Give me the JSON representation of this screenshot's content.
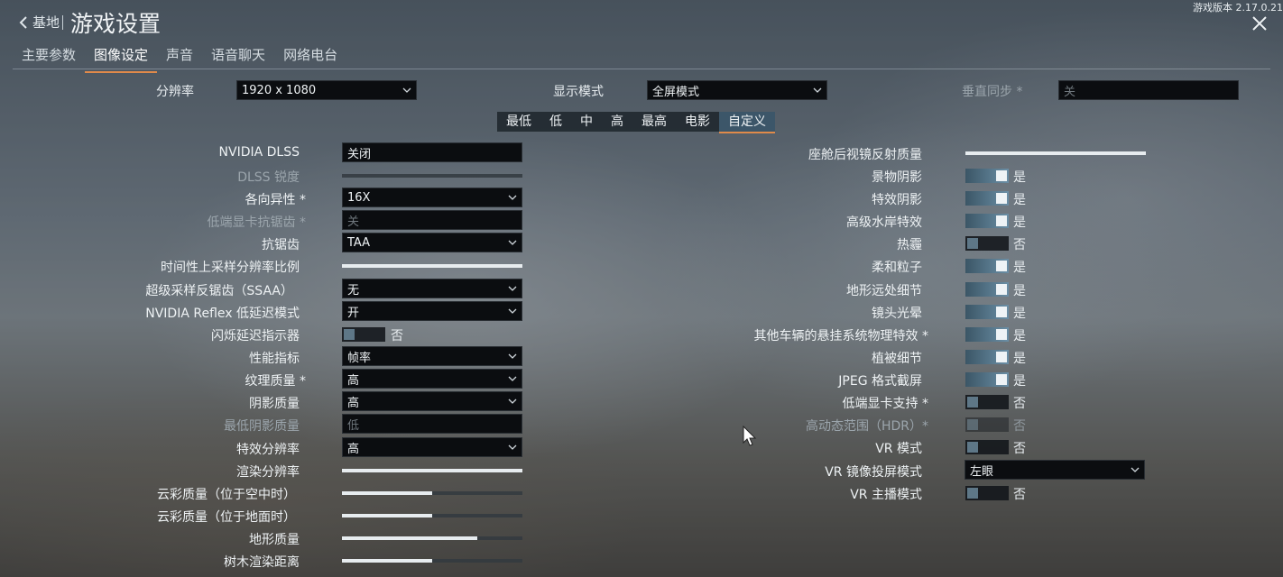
{
  "header": {
    "back_label": "基地",
    "title": "游戏设置",
    "version": "游戏版本 2.17.0.21"
  },
  "tabs": [
    "主要参数",
    "图像设定",
    "声音",
    "语音聊天",
    "网络电台"
  ],
  "top": {
    "resolution_label": "分辨率",
    "resolution_value": "1920 x 1080",
    "display_mode_label": "显示模式",
    "display_mode_value": "全屏模式",
    "vsync_label": "垂直同步 *",
    "vsync_value": "关"
  },
  "presets": [
    "最低",
    "低",
    "中",
    "高",
    "最高",
    "电影",
    "自定义"
  ],
  "left": {
    "dlss_label": "NVIDIA DLSS",
    "dlss_value": "关闭",
    "dlss_sharpness_label": "DLSS 锐度",
    "aniso_label": "各向异性 *",
    "aniso_value": "16X",
    "lowend_aa_label": "低端显卡抗锯齿 *",
    "lowend_aa_value": "关",
    "aa_label": "抗锯齿",
    "aa_value": "TAA",
    "temporal_upscale_label": "时间性上采样分辨率比例",
    "temporal_upscale_level": 1.0,
    "ssaa_label": "超级采样反锯齿（SSAA）",
    "ssaa_value": "无",
    "reflex_label": "NVIDIA Reflex 低延迟模式",
    "reflex_value": "开",
    "flash_label": "闪烁延迟指示器",
    "flash_value": "否",
    "perf_label": "性能指标",
    "perf_value": "帧率",
    "texture_label": "纹理质量 *",
    "texture_value": "高",
    "shadow_label": "阴影质量",
    "shadow_value": "高",
    "min_shadow_label": "最低阴影质量",
    "min_shadow_value": "低",
    "fx_res_label": "特效分辨率",
    "fx_res_value": "高",
    "render_res_label": "渲染分辨率",
    "render_res_level": 1.0,
    "cloud_air_label": "云彩质量（位于空中时）",
    "cloud_air_level": 0.5,
    "cloud_ground_label": "云彩质量（位于地面时）",
    "cloud_ground_level": 0.5,
    "terrain_label": "地形质量",
    "terrain_level": 0.75,
    "tree_label": "树木渲染距离",
    "tree_level": 0.5
  },
  "right": {
    "mirror_label": "座舱后视镜反射质量",
    "mirror_level": 1.0,
    "items": [
      {
        "label": "景物阴影",
        "value": "是"
      },
      {
        "label": "特效阴影",
        "value": "是"
      },
      {
        "label": "高级水岸特效",
        "value": "是"
      },
      {
        "label": "热霾",
        "value": "否"
      },
      {
        "label": "柔和粒子",
        "value": "是"
      },
      {
        "label": "地形远处细节",
        "value": "是"
      },
      {
        "label": "镜头光晕",
        "value": "是"
      },
      {
        "label": "其他车辆的悬挂系统物理特效 *",
        "value": "是"
      },
      {
        "label": "植被细节",
        "value": "是"
      },
      {
        "label": "JPEG 格式截屏",
        "value": "是"
      },
      {
        "label": "低端显卡支持 *",
        "value": "否"
      },
      {
        "label": "高动态范围（HDR）*",
        "value": "否"
      },
      {
        "label": "VR 模式",
        "value": "否"
      }
    ],
    "vr_mirror_label": "VR 镜像投屏模式",
    "vr_mirror_value": "左眼",
    "vr_stream_label": "VR 主播模式",
    "vr_stream_value": "否"
  }
}
